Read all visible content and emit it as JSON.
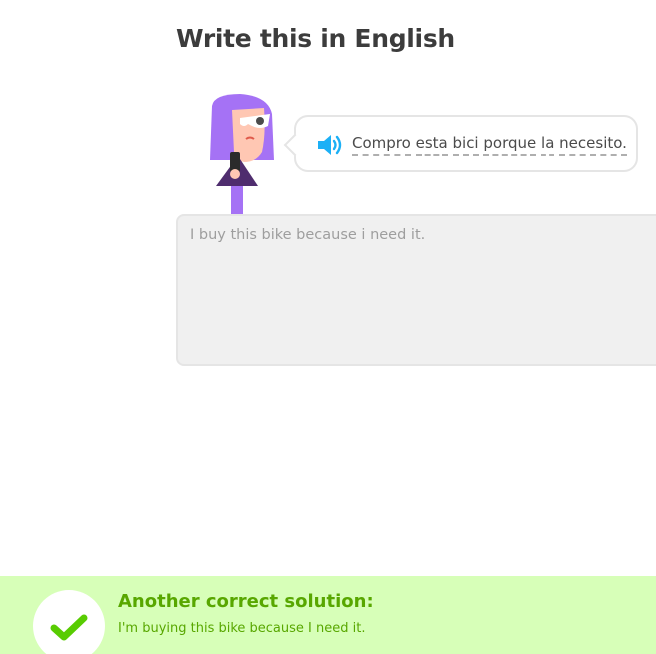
{
  "header": {
    "title": "Write this in English"
  },
  "prompt": {
    "speaker_icon": "speaker-icon",
    "words": [
      "Compro",
      "esta",
      "bici",
      "porque",
      "la",
      "necesito."
    ]
  },
  "answer": {
    "value": "I buy this bike because i need it."
  },
  "feedback": {
    "icon": "checkmark-icon",
    "heading": "Another correct solution:",
    "solution": "I'm buying this bike because I need it."
  },
  "colors": {
    "success_bg": "#d7ffb8",
    "success_text": "#58a700",
    "check": "#58cc02",
    "speaker": "#1cb0f6",
    "character_hair": "#a572f5"
  }
}
